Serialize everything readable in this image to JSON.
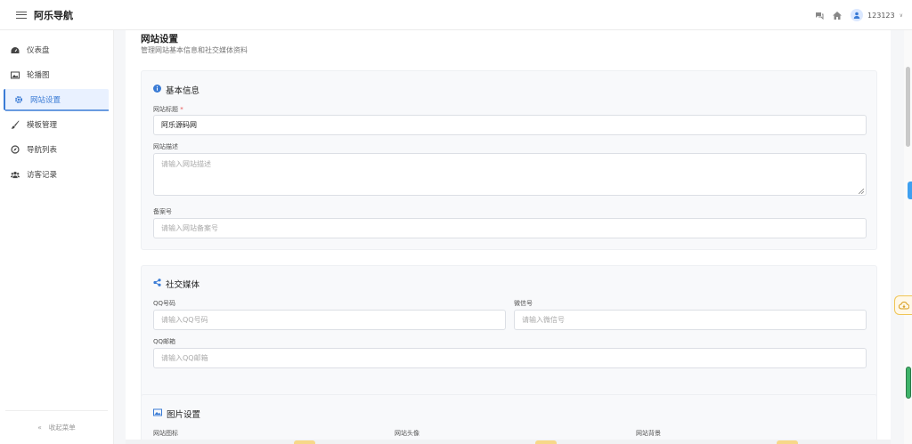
{
  "header": {
    "brand": "阿乐导航",
    "username": "123123",
    "chevron": "∨",
    "icons": [
      "menu-icon",
      "chat-icon",
      "home-icon",
      "user-icon",
      "chevron-down-icon"
    ]
  },
  "sidebar": {
    "items": [
      {
        "label": "仪表盘",
        "icon": "dashboard-icon"
      },
      {
        "label": "轮播图",
        "icon": "image-icon"
      },
      {
        "label": "网站设置",
        "icon": "gear-icon",
        "active": true
      },
      {
        "label": "模板管理",
        "icon": "brush-icon"
      },
      {
        "label": "导航列表",
        "icon": "compass-icon"
      },
      {
        "label": "访客记录",
        "icon": "users-icon"
      }
    ],
    "collapse_label": "收起菜单",
    "collapse_icon": "«"
  },
  "page": {
    "title": "网站设置",
    "subtitle": "管理网站基本信息和社交媒体资料"
  },
  "basic": {
    "title": "基本信息",
    "site_title_label": "网站标题",
    "required_mark": "*",
    "site_title_value": "阿乐源码网",
    "desc_label": "网站描述",
    "desc_placeholder": "请输入网站描述",
    "icp_label": "备案号",
    "icp_placeholder": "请输入网站备案号"
  },
  "social": {
    "title": "社交媒体",
    "qq_label": "QQ号码",
    "qq_placeholder": "请输入QQ号码",
    "wechat_label": "微信号",
    "wechat_placeholder": "请输入微信号",
    "qqmail_label": "QQ邮箱",
    "qqmail_placeholder": "请输入QQ邮箱"
  },
  "images": {
    "title": "图片设置",
    "icon_label": "网站图标",
    "avatar_label": "网站头像",
    "bg_label": "网站背景"
  },
  "colors": {
    "accent": "#3a7bd5",
    "active_bg": "#e9f1ff",
    "required": "#e64c4c"
  }
}
